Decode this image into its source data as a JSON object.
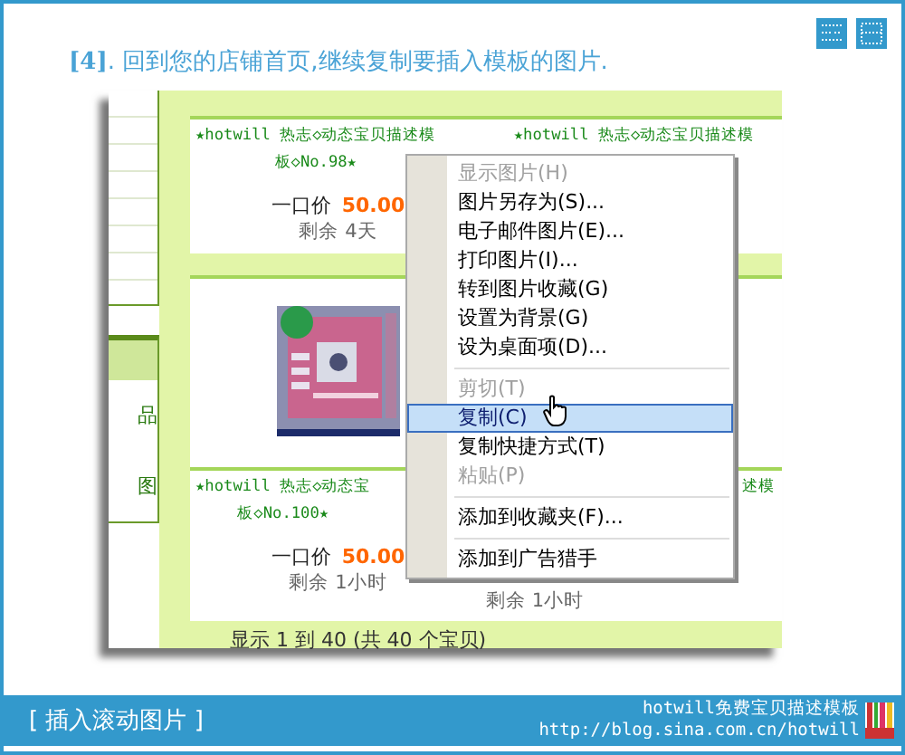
{
  "instruction": "**[4]**. 回到您的店铺首页,继续复制要插入模板的图片.",
  "sidebar": {
    "items": [
      "品",
      "图"
    ]
  },
  "products": [
    {
      "kind": "item",
      "title": [
        "★hotwill 热志◇动态宝贝描述模",
        "板◇No.98★"
      ],
      "price_label": "一口价",
      "price": "50.00",
      "remaining": "剩余 4天"
    },
    {
      "kind": "title_only",
      "title": [
        "★hotwill 热志◇动态宝贝描述模"
      ]
    },
    {
      "kind": "picture"
    },
    {
      "kind": "empty"
    },
    {
      "kind": "item",
      "title": [
        "★hotwill 热志◇动态宝",
        "板◇No.100★"
      ],
      "price_label": "一口价",
      "price": "50.00",
      "remaining": "剩余 1小时"
    },
    {
      "kind": "partial",
      "title": [
        "述模"
      ],
      "remaining": "剩余 1小时"
    }
  ],
  "footer_count": "显示 1 到 40 (共 40 个宝贝)",
  "context_menu": [
    {
      "kind": "item",
      "label": "显示图片(H)",
      "disabled": true,
      "selected": false
    },
    {
      "kind": "item",
      "label": "图片另存为(S)...",
      "disabled": false,
      "selected": false
    },
    {
      "kind": "item",
      "label": "电子邮件图片(E)...",
      "disabled": false,
      "selected": false
    },
    {
      "kind": "item",
      "label": "打印图片(I)...",
      "disabled": false,
      "selected": false
    },
    {
      "kind": "item",
      "label": "转到图片收藏(G)",
      "disabled": false,
      "selected": false
    },
    {
      "kind": "item",
      "label": "设置为背景(G)",
      "disabled": false,
      "selected": false
    },
    {
      "kind": "item",
      "label": "设为桌面项(D)...",
      "disabled": false,
      "selected": false
    },
    {
      "kind": "separator"
    },
    {
      "kind": "item",
      "label": "剪切(T)",
      "disabled": true,
      "selected": false
    },
    {
      "kind": "item",
      "label": "复制(C)",
      "disabled": false,
      "selected": true
    },
    {
      "kind": "item",
      "label": "复制快捷方式(T)",
      "disabled": false,
      "selected": false
    },
    {
      "kind": "item",
      "label": "粘贴(P)",
      "disabled": true,
      "selected": false
    },
    {
      "kind": "separator"
    },
    {
      "kind": "item",
      "label": "添加到收藏夹(F)...",
      "disabled": false,
      "selected": false
    },
    {
      "kind": "separator"
    },
    {
      "kind": "item",
      "label": "添加到广告猎手",
      "disabled": false,
      "selected": false
    }
  ],
  "bottom_bar": {
    "section": "[ 插入滚动图片 ]",
    "brand": "hotwill免费宝贝描述模板",
    "url": "http://blog.sina.com.cn/hotwill"
  }
}
